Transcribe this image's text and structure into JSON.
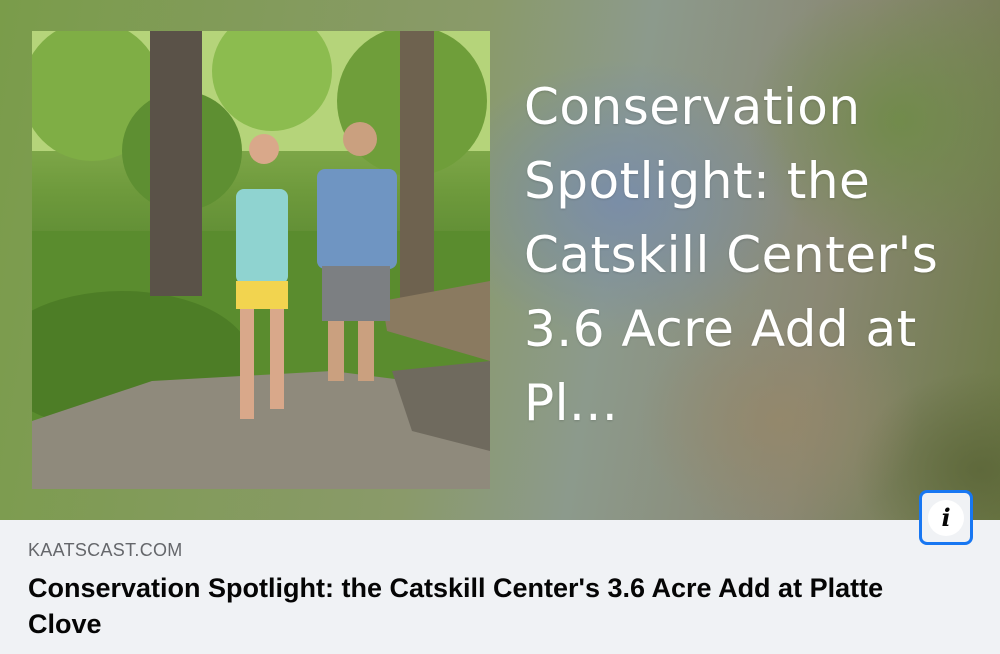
{
  "link_preview": {
    "overlay_title": "Conservation Spotlight: the Catskill Center's 3.6 Acre Add at Pl...",
    "domain": "KAATSCAST.COM",
    "title": "Conservation Spotlight: the Catskill Center's 3.6 Acre Add at Platte Clove",
    "info_icon": "i"
  }
}
